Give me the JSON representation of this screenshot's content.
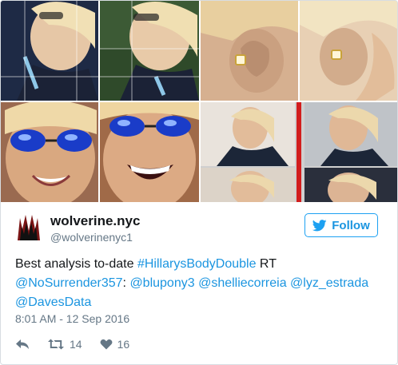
{
  "tweet": {
    "display_name": "wolverine.nyc",
    "handle": "@wolverinenyc1",
    "follow_label": "Follow",
    "text_prefix": "Best analysis to-date ",
    "hashtag": "#HillarysBodyDouble",
    "text_rt": " RT",
    "mention_source": "@NoSurrender357",
    "colon": ": ",
    "mentions": [
      "@blupony3",
      "@shelliecorreia",
      "@lyz_estrada",
      "@DavesData"
    ],
    "timestamp": "8:01 AM - 12 Sep 2016",
    "retweet_count": "14",
    "like_count": "16"
  },
  "colors": {
    "link": "#1b95e0",
    "follow_border": "#1da1f2",
    "meta_text": "#657786"
  },
  "icons": {
    "reply": "reply-icon",
    "retweet": "retweet-icon",
    "like": "heart-icon",
    "follow_bird": "twitter-bird-icon",
    "avatar": "wolverine-logo-icon"
  }
}
